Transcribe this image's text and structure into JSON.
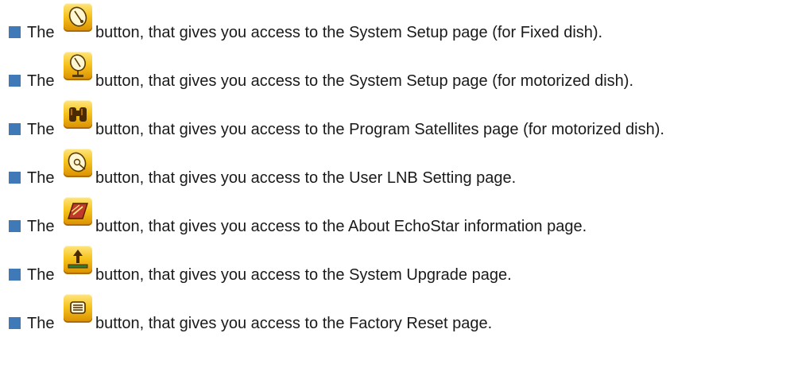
{
  "items": [
    {
      "lead": "The",
      "icon": "fixed-dish-icon",
      "text": " button, that gives you access to the System Setup page (for Fixed dish)."
    },
    {
      "lead": "The",
      "icon": "motorized-dish-icon",
      "text": " button, that gives you access to the System Setup page (for motorized dish)."
    },
    {
      "lead": "The",
      "icon": "binoculars-icon",
      "text": " button, that gives you access to the Program Satellites page (for motorized dish)."
    },
    {
      "lead": "The",
      "icon": "lnb-dish-icon",
      "text": " button, that gives you access to the User LNB Setting page."
    },
    {
      "lead": "The",
      "icon": "about-echostar-icon",
      "text": " button, that gives you access to the About EchoStar information page."
    },
    {
      "lead": "The",
      "icon": "upgrade-arrow-icon",
      "text": " button, that gives you access to the System Upgrade page."
    },
    {
      "lead": "The",
      "icon": "factory-reset-icon",
      "text": " button, that gives you access to the Factory Reset page."
    }
  ],
  "colors": {
    "bullet": "#3f79b8",
    "text": "#1a1a1a",
    "icon_fill": "#f7c31c"
  }
}
